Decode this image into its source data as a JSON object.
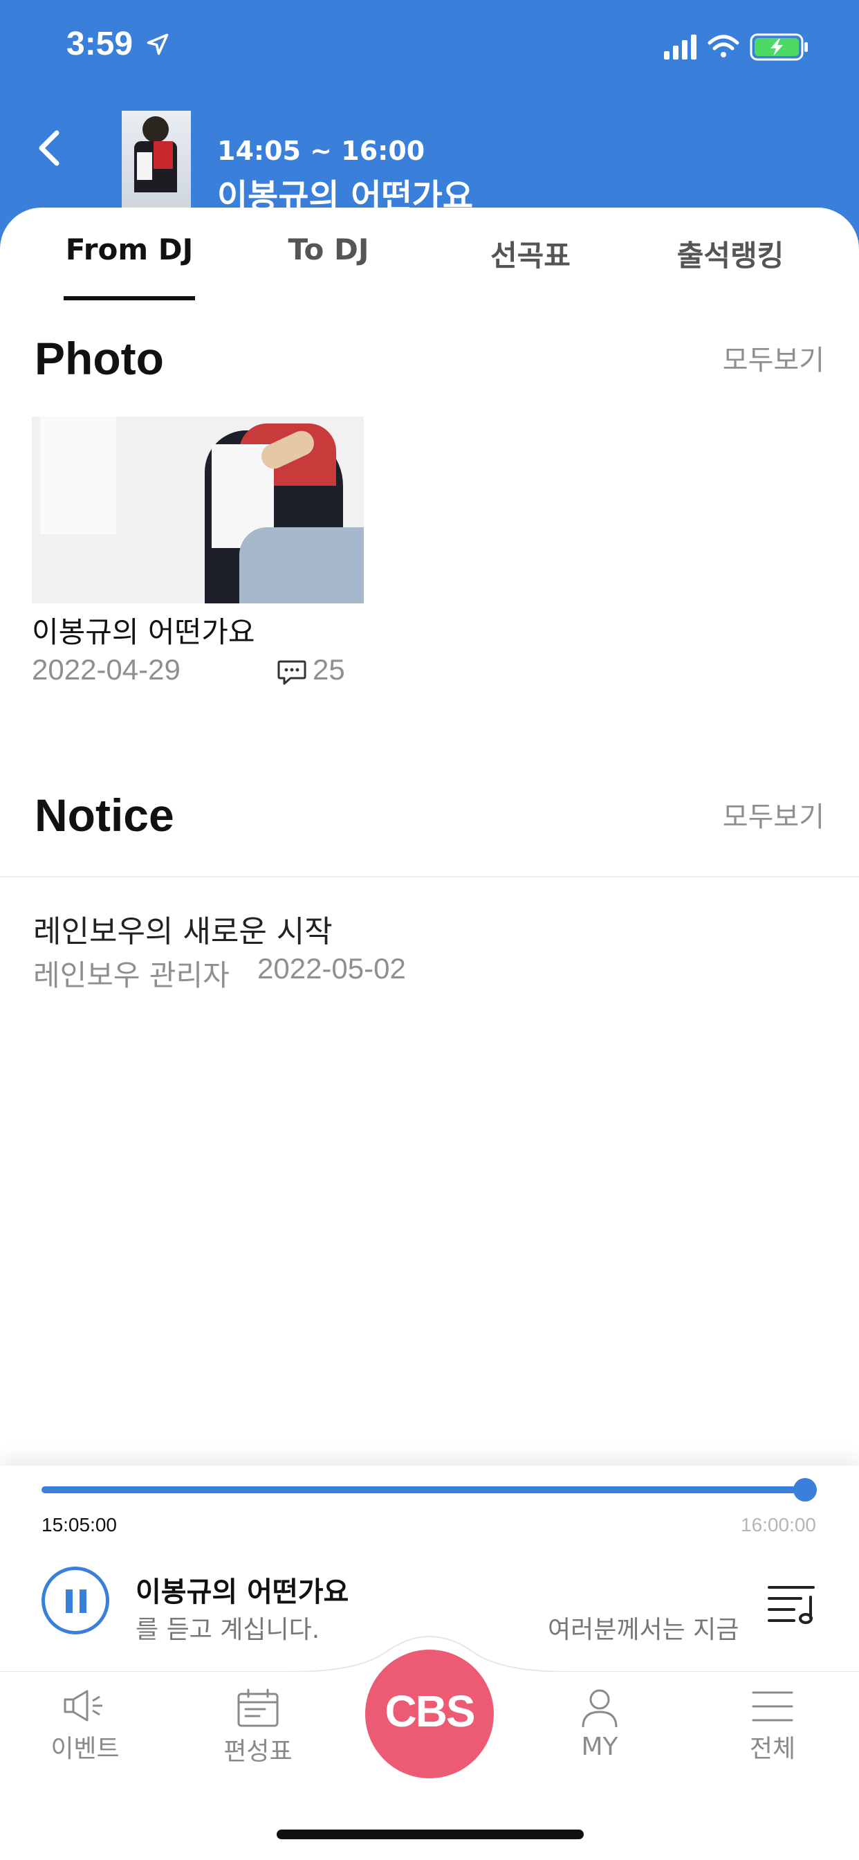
{
  "status_bar": {
    "time": "3:59"
  },
  "header": {
    "time_range": "14:05 ~ 16:00",
    "program_title": "이봉규의 어떤가요"
  },
  "tabs": [
    {
      "label": "From DJ",
      "active": true
    },
    {
      "label": "To DJ",
      "active": false
    },
    {
      "label": "선곡표",
      "active": false
    },
    {
      "label": "출석랭킹",
      "active": false
    }
  ],
  "photo_section": {
    "title": "Photo",
    "see_all": "모두보기",
    "items": [
      {
        "title": "이봉규의 어떤가요",
        "date": "2022-04-29",
        "comments": "25"
      }
    ]
  },
  "notice_section": {
    "title": "Notice",
    "see_all": "모두보기",
    "items": [
      {
        "title": "레인보우의 새로운 시작",
        "author": "레인보우 관리자",
        "date": "2022-05-02"
      }
    ]
  },
  "player": {
    "start_time": "15:05:00",
    "end_time": "16:00:00",
    "progress": 1.0,
    "title": "이봉규의 어떤가요",
    "ticker_left": "를 듣고 계십니다.",
    "ticker_right": "여러분께서는 지금"
  },
  "tabbar": {
    "items": [
      {
        "label": "이벤트",
        "icon": "megaphone-icon"
      },
      {
        "label": "편성표",
        "icon": "calendar-icon"
      },
      {
        "label": "CBS",
        "icon": "cbs-logo"
      },
      {
        "label": "MY",
        "icon": "person-icon"
      },
      {
        "label": "전체",
        "icon": "menu-icon"
      }
    ]
  },
  "colors": {
    "accent": "#3a7fd9",
    "cbs": "#ec5b73"
  }
}
